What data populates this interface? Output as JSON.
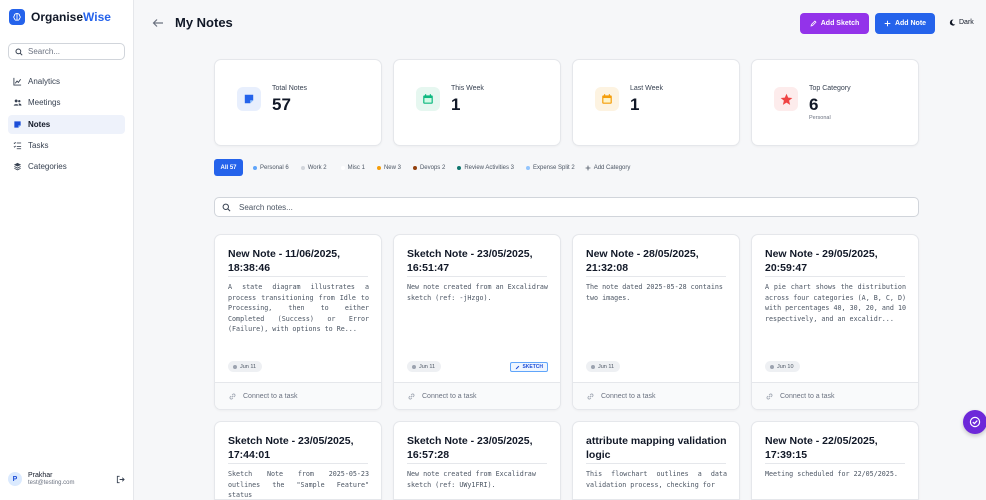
{
  "brand": {
    "name_primary": "Organise",
    "name_accent": "Wise"
  },
  "sidebar": {
    "search_placeholder": "Search...",
    "items": [
      {
        "label": "Analytics",
        "icon": "chart-line-icon",
        "active": false
      },
      {
        "label": "Meetings",
        "icon": "users-icon",
        "active": false
      },
      {
        "label": "Notes",
        "icon": "note-icon",
        "active": true
      },
      {
        "label": "Tasks",
        "icon": "list-check-icon",
        "active": false
      },
      {
        "label": "Categories",
        "icon": "layers-icon",
        "active": false
      }
    ],
    "user": {
      "initial": "P",
      "name": "Prakhar",
      "email": "test@testing.com"
    }
  },
  "header": {
    "title": "My Notes",
    "add_sketch_label": "Add Sketch",
    "add_note_label": "Add Note",
    "theme_label": "Dark"
  },
  "stats": [
    {
      "label": "Total Notes",
      "value": "57",
      "sub": "",
      "icon": "note-icon",
      "color": "#2563eb",
      "bg": "#e8effd"
    },
    {
      "label": "This Week",
      "value": "1",
      "sub": "",
      "icon": "calendar-icon",
      "color": "#10b981",
      "bg": "#e6f7f0"
    },
    {
      "label": "Last Week",
      "value": "1",
      "sub": "",
      "icon": "calendar-icon",
      "color": "#f59e0b",
      "bg": "#fdf3e1"
    },
    {
      "label": "Top Category",
      "value": "6",
      "sub": "Personal",
      "icon": "star-icon",
      "color": "#ef4444",
      "bg": "#fdecec"
    }
  ],
  "categories": [
    {
      "label": "All 57",
      "color": "#2563eb"
    },
    {
      "label": "Personal 6",
      "color": "#60a5fa"
    },
    {
      "label": "Work 2",
      "color": "#d1d5db"
    },
    {
      "label": "Misc 1",
      "color": "#ffffff"
    },
    {
      "label": "New 3",
      "color": "#f59e0b"
    },
    {
      "label": "Devops 2",
      "color": "#92400e"
    },
    {
      "label": "Review Activities 3",
      "color": "#0f766e"
    },
    {
      "label": "Expense Split 2",
      "color": "#93c5fd"
    }
  ],
  "add_category_label": "Add Category",
  "notes_search_placeholder": "Search notes...",
  "notes": [
    {
      "title": "New Note - 11/06/2025, 18:38:46",
      "desc": "A state diagram illustrates a process transitioning from Idle to Processing, then to either Completed (Success) or Error (Failure), with options to Re...",
      "date": "Jun 11",
      "badge": "",
      "footer": "Connect to a task"
    },
    {
      "title": "Sketch Note - 23/05/2025, 16:51:47",
      "desc": "New note created from an Excalidraw sketch (ref: -jHzgo).",
      "date": "Jun 11",
      "badge": "SKETCH",
      "footer": "Connect to a task"
    },
    {
      "title": "New Note - 28/05/2025, 21:32:08",
      "desc": "The note dated 2025-05-28 contains two images.",
      "date": "Jun 11",
      "badge": "",
      "footer": "Connect to a task"
    },
    {
      "title": "New Note - 29/05/2025, 20:59:47",
      "desc": "A pie chart shows the distribution across four categories (A, B, C, D) with percentages 40, 30, 20, and 10 respectively, and an excalidr...",
      "date": "Jun 10",
      "badge": "",
      "footer": "Connect to a task"
    },
    {
      "title": "Sketch Note - 23/05/2025, 17:44:01",
      "desc": "Sketch Note from 2025-05-23 outlines the \"Sample Feature\" status",
      "date": "",
      "badge": "",
      "footer": ""
    },
    {
      "title": "Sketch Note - 23/05/2025, 16:57:28",
      "desc": "New note created from Excalidraw sketch (ref: UWy1FRI).",
      "date": "",
      "badge": "",
      "footer": ""
    },
    {
      "title": "attribute mapping validation logic",
      "desc": "This flowchart outlines a data validation process, checking for",
      "date": "",
      "badge": "",
      "footer": ""
    },
    {
      "title": "New Note - 22/05/2025, 17:39:15",
      "desc": "Meeting scheduled for 22/05/2025.",
      "date": "",
      "badge": "",
      "footer": ""
    }
  ]
}
